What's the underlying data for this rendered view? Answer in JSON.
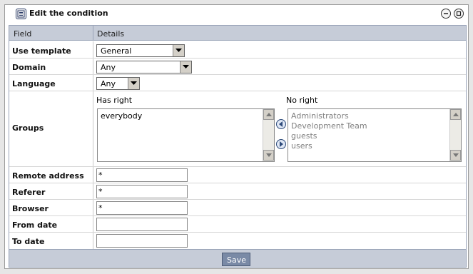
{
  "window": {
    "title": "Edit the condition"
  },
  "table": {
    "header_field": "Field",
    "header_details": "Details"
  },
  "rows": {
    "use_template": {
      "label": "Use template",
      "value": "General"
    },
    "domain": {
      "label": "Domain",
      "value": "Any"
    },
    "language": {
      "label": "Language",
      "value": "Any"
    },
    "groups": {
      "label": "Groups",
      "has_right_label": "Has right",
      "no_right_label": "No right",
      "has_right_items": [
        "everybody"
      ],
      "no_right_items": [
        "Administrators",
        "Development Team",
        "guests",
        "users"
      ]
    },
    "remote_address": {
      "label": "Remote address",
      "value": "*"
    },
    "referer": {
      "label": "Referer",
      "value": "*"
    },
    "browser": {
      "label": "Browser",
      "value": "*"
    },
    "from_date": {
      "label": "From date",
      "value": ""
    },
    "to_date": {
      "label": "To date",
      "value": ""
    }
  },
  "footer": {
    "save_label": "Save"
  },
  "icons": {
    "title": "edit-document-icon",
    "minimize": "minimize-icon",
    "close": "close-icon",
    "move_left": "arrow-left-icon",
    "move_right": "arrow-right-icon"
  },
  "colors": {
    "header_bg": "#c6ccd8",
    "button_bg": "#7a8aa6",
    "disabled_text": "#808080"
  }
}
